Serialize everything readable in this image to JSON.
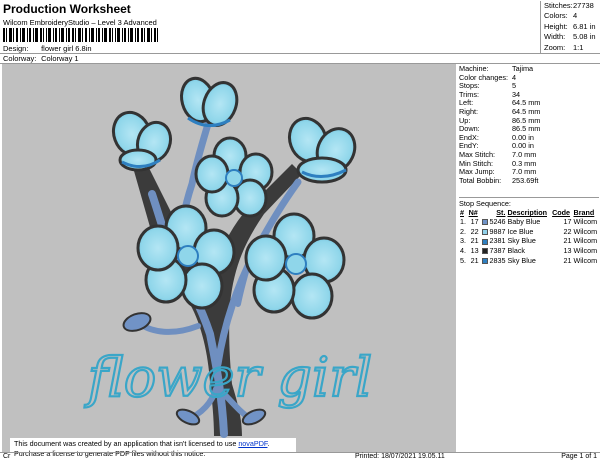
{
  "header": {
    "title": "Production Worksheet",
    "subtitle": "Wilcom EmbroideryStudio – Level 3 Advanced",
    "design_label": "Design:",
    "design_value": "flower girl 6.8in",
    "colorway_label": "Colorway:",
    "colorway_value": "Colorway 1"
  },
  "stats": [
    {
      "label": "Stitches:",
      "value": "27738"
    },
    {
      "label": "Colors:",
      "value": "4"
    },
    {
      "label": "Height:",
      "value": "6.81 in"
    },
    {
      "label": "Width:",
      "value": "5.08 in"
    },
    {
      "label": "Zoom:",
      "value": "1:1"
    }
  ],
  "machine_info": [
    {
      "label": "Machine:",
      "value": "Tajima"
    },
    {
      "label": "Color changes:",
      "value": "4"
    },
    {
      "label": "Stops:",
      "value": "5"
    },
    {
      "label": "Trims:",
      "value": "34"
    },
    {
      "label": "Left:",
      "value": "64.5 mm"
    },
    {
      "label": "Right:",
      "value": "64.5 mm"
    },
    {
      "label": "Up:",
      "value": "86.5 mm"
    },
    {
      "label": "Down:",
      "value": "86.5 mm"
    },
    {
      "label": "EndX:",
      "value": "0.00 in"
    },
    {
      "label": "EndY:",
      "value": "0.00 in"
    },
    {
      "label": "Max Stitch:",
      "value": "7.0 mm"
    },
    {
      "label": "Min Stitch:",
      "value": "0.3 mm"
    },
    {
      "label": "Max Jump:",
      "value": "7.0 mm"
    },
    {
      "label": "Total Bobbin:",
      "value": "253.69ft"
    }
  ],
  "stop_sequence": {
    "title": "Stop Sequence:",
    "headers": [
      "#",
      "N#",
      "St.",
      "Description",
      "Code",
      "Brand"
    ],
    "rows": [
      {
        "idx": "1.",
        "n": "17",
        "st": "5246",
        "color": "#6f93c8",
        "desc": "Baby Blue",
        "code": "17",
        "brand": "Wilcom"
      },
      {
        "idx": "2.",
        "n": "22",
        "st": "9887",
        "color": "#8fd0ea",
        "desc": "Ice Blue",
        "code": "22",
        "brand": "Wilcom"
      },
      {
        "idx": "3.",
        "n": "21",
        "st": "2381",
        "color": "#2e7fc0",
        "desc": "Sky Blue",
        "code": "21",
        "brand": "Wilcom"
      },
      {
        "idx": "4.",
        "n": "13",
        "st": "7387",
        "color": "#222222",
        "desc": "Black",
        "code": "13",
        "brand": "Wilcom"
      },
      {
        "idx": "5.",
        "n": "21",
        "st": "2835",
        "color": "#2e7fc0",
        "desc": "Sky Blue",
        "code": "21",
        "brand": "Wilcom"
      }
    ]
  },
  "design_text": "flower girl",
  "notice": {
    "line1_prefix": "This document was created by an application that isn't licensed to use ",
    "link": "novaPDF",
    "line1_suffix": ".",
    "line2": "Purchase a license to generate PDF files without this notice."
  },
  "footer": {
    "left": "Cr",
    "printed": "Printed: 18/07/2021 19.05.11",
    "page": "Page 1 of 1"
  },
  "colors": {
    "background_canvas": "#c0c0c0",
    "petal_fill": "#8fd6ea",
    "petal_shadow": "#5fb3d6",
    "outline": "#333333",
    "stem": "#6f8fc0",
    "script_text": "#3aa6c8",
    "link": "#0033cc"
  }
}
